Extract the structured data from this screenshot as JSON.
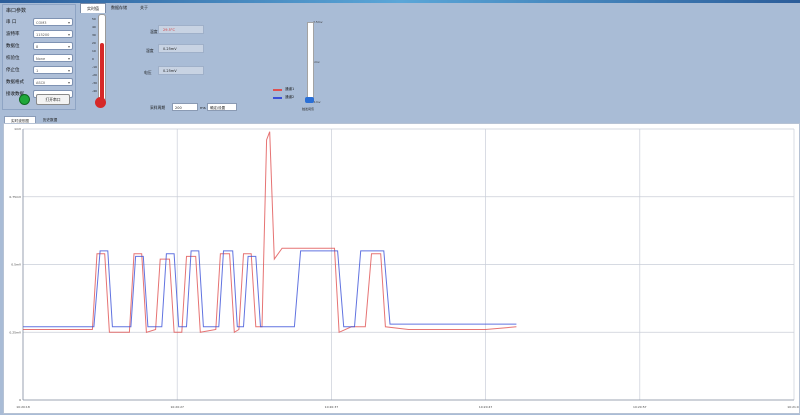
{
  "panel": {
    "title": "串口参数",
    "fields": [
      {
        "label": "串  口",
        "value": "COM3"
      },
      {
        "label": "波特率",
        "value": "115200"
      },
      {
        "label": "数据位",
        "value": "8"
      },
      {
        "label": "校验位",
        "value": "None"
      },
      {
        "label": "停止位",
        "value": "1"
      },
      {
        "label": "数据格式",
        "value": "ASCII"
      },
      {
        "label": "接收数据",
        "value": ""
      }
    ],
    "open_button": "打开串口"
  },
  "top_tabs": [
    "实时值",
    "数据存储",
    "关于"
  ],
  "thermometer": {
    "scale": [
      "50",
      "40",
      "30",
      "20",
      "10",
      "0",
      "-10",
      "-20",
      "-30",
      "-40"
    ],
    "fill_fraction": 0.68
  },
  "readings": [
    {
      "label": "温度",
      "value": "29.5°C",
      "color": "#d63a3a"
    },
    {
      "label": "湿度",
      "value": "0.25mV"
    },
    {
      "label": "电压",
      "value": "0.25mV"
    }
  ],
  "legend": [
    {
      "label": "通道1",
      "color": "#e05050"
    },
    {
      "label": "通道2",
      "color": "#3a50d8"
    }
  ],
  "slider": {
    "top": "2.5mv",
    "mid": "1mv",
    "bottom": "0.1mv",
    "caption": "触发阈值",
    "level": 0.04
  },
  "period": {
    "label": "采样周期",
    "value": "200",
    "unit": "ms",
    "button": "确定/设置"
  },
  "chart_tabs": [
    "实时波形图",
    "历史数据"
  ],
  "colors": {
    "series1": "#e05050",
    "series2": "#3a50d8"
  },
  "chart_data": {
    "type": "line",
    "ylim": [
      0,
      1
    ],
    "y_ticks": [
      "0",
      "0.25mV",
      "0.5mV",
      "0.75mV",
      "1mV"
    ],
    "x_ticks": [
      "10:20:18",
      "10:20:27",
      "10:20:37",
      "10:20:47",
      "10:20:57",
      "10:21:07"
    ],
    "x_range": [
      0,
      50
    ],
    "series": [
      {
        "color": "#e05050",
        "points": [
          [
            0,
            0.26
          ],
          [
            4.5,
            0.26
          ],
          [
            4.8,
            0.54
          ],
          [
            5.3,
            0.54
          ],
          [
            5.6,
            0.25
          ],
          [
            6.9,
            0.25
          ],
          [
            7.2,
            0.54
          ],
          [
            7.7,
            0.54
          ],
          [
            8.0,
            0.25
          ],
          [
            8.6,
            0.26
          ],
          [
            8.9,
            0.52
          ],
          [
            9.5,
            0.52
          ],
          [
            9.8,
            0.25
          ],
          [
            10.3,
            0.25
          ],
          [
            10.6,
            0.53
          ],
          [
            11.2,
            0.53
          ],
          [
            11.5,
            0.25
          ],
          [
            12.5,
            0.26
          ],
          [
            12.8,
            0.54
          ],
          [
            13.4,
            0.54
          ],
          [
            13.7,
            0.25
          ],
          [
            14.0,
            0.26
          ],
          [
            14.3,
            0.54
          ],
          [
            14.8,
            0.54
          ],
          [
            15.1,
            0.27
          ],
          [
            15.5,
            0.27
          ],
          [
            15.8,
            0.96
          ],
          [
            16.0,
            0.99
          ],
          [
            16.3,
            0.52
          ],
          [
            16.8,
            0.56
          ],
          [
            17.2,
            0.56
          ],
          [
            18.5,
            0.56
          ],
          [
            19.5,
            0.56
          ],
          [
            20.2,
            0.56
          ],
          [
            20.5,
            0.25
          ],
          [
            21.3,
            0.27
          ],
          [
            22.2,
            0.27
          ],
          [
            22.6,
            0.54
          ],
          [
            23.2,
            0.54
          ],
          [
            23.5,
            0.27
          ],
          [
            25,
            0.26
          ],
          [
            30,
            0.26
          ],
          [
            32,
            0.27
          ]
        ]
      },
      {
        "color": "#3a50d8",
        "points": [
          [
            0,
            0.27
          ],
          [
            4.6,
            0.27
          ],
          [
            5.0,
            0.55
          ],
          [
            5.5,
            0.55
          ],
          [
            5.8,
            0.27
          ],
          [
            7.0,
            0.27
          ],
          [
            7.3,
            0.53
          ],
          [
            7.8,
            0.53
          ],
          [
            8.1,
            0.27
          ],
          [
            9.0,
            0.27
          ],
          [
            9.3,
            0.54
          ],
          [
            9.8,
            0.54
          ],
          [
            10.1,
            0.27
          ],
          [
            10.6,
            0.27
          ],
          [
            10.9,
            0.55
          ],
          [
            11.4,
            0.55
          ],
          [
            11.7,
            0.27
          ],
          [
            12.7,
            0.27
          ],
          [
            13.0,
            0.55
          ],
          [
            13.6,
            0.55
          ],
          [
            13.9,
            0.27
          ],
          [
            14.3,
            0.27
          ],
          [
            14.6,
            0.53
          ],
          [
            15.1,
            0.53
          ],
          [
            15.4,
            0.27
          ],
          [
            17.6,
            0.27
          ],
          [
            18.0,
            0.55
          ],
          [
            19.2,
            0.55
          ],
          [
            20.4,
            0.55
          ],
          [
            20.8,
            0.27
          ],
          [
            21.5,
            0.27
          ],
          [
            21.9,
            0.55
          ],
          [
            23.4,
            0.55
          ],
          [
            23.8,
            0.28
          ],
          [
            26,
            0.28
          ],
          [
            30,
            0.28
          ],
          [
            32,
            0.28
          ]
        ]
      }
    ]
  }
}
